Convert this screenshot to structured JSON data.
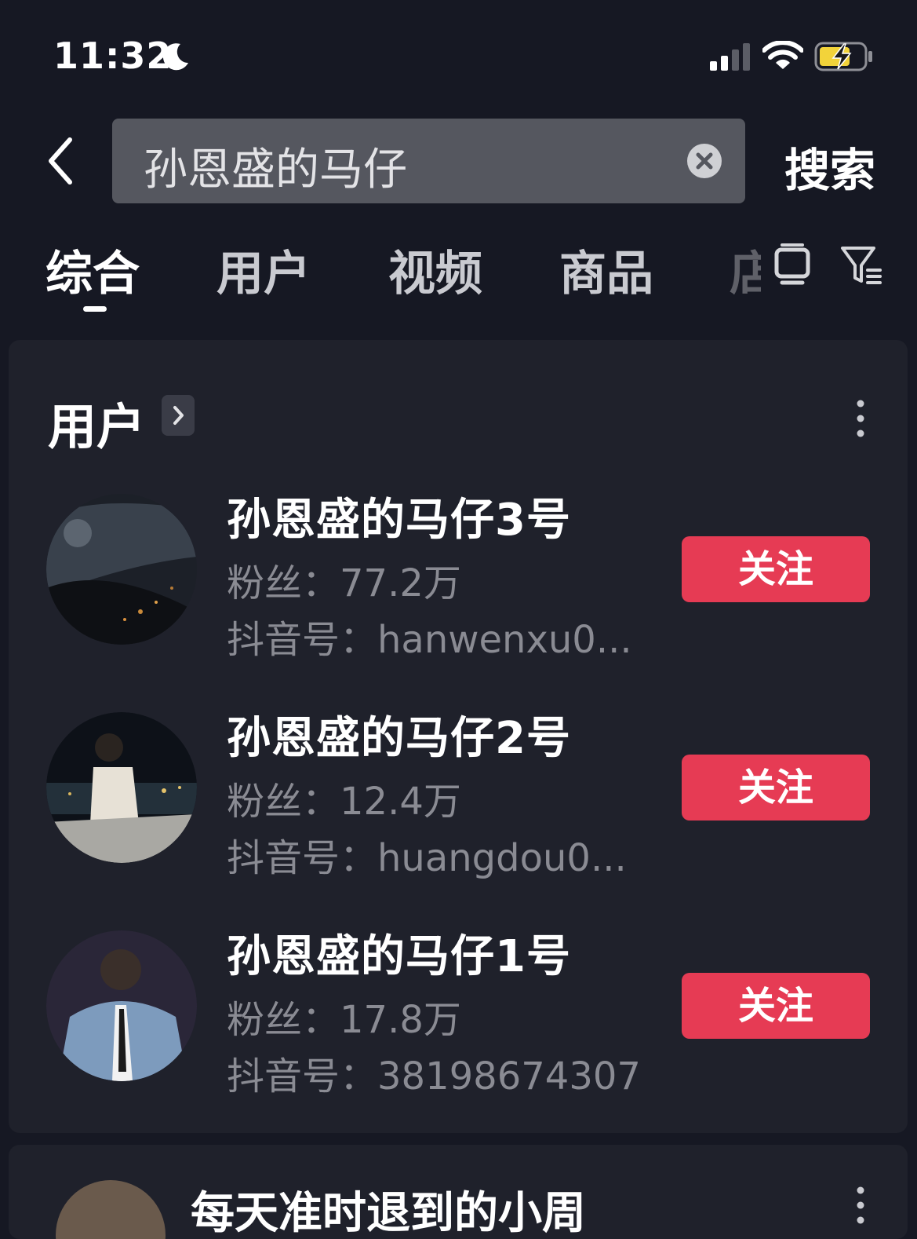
{
  "status_bar": {
    "time": "11:32"
  },
  "search": {
    "query": "孙恩盛的马仔",
    "submit_label": "搜索"
  },
  "tabs": [
    {
      "label": "综合"
    },
    {
      "label": "用户"
    },
    {
      "label": "视频"
    },
    {
      "label": "商品"
    },
    {
      "label": "店"
    }
  ],
  "user_section": {
    "title": "用户",
    "users": [
      {
        "name": "孙恩盛的马仔3号",
        "fans": "粉丝：77.2万",
        "id": "抖音号：hanwenxu0...",
        "follow_label": "关注"
      },
      {
        "name": "孙恩盛的马仔2号",
        "fans": "粉丝：12.4万",
        "id": "抖音号：huangdou0...",
        "follow_label": "关注"
      },
      {
        "name": "孙恩盛的马仔1号",
        "fans": "粉丝：17.8万",
        "id": "抖音号：38198674307",
        "follow_label": "关注"
      }
    ]
  },
  "next_card": {
    "title": "每天准时退到的小周"
  },
  "colors": {
    "background": "#161823",
    "card": "#1f212b",
    "follow": "#e63b54",
    "search_box": "#55575f"
  }
}
